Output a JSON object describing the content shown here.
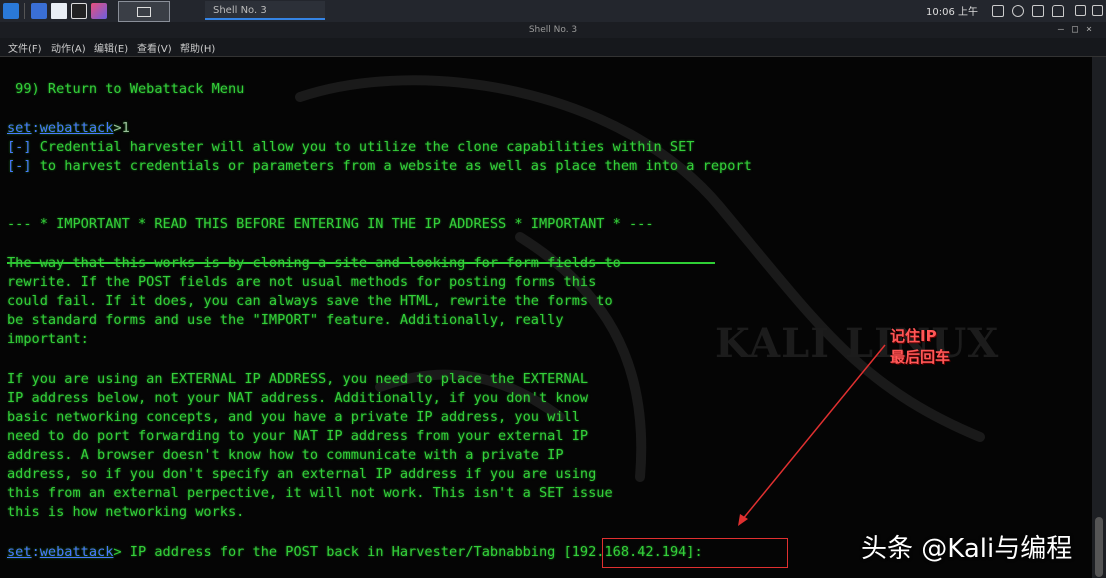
{
  "taskbar": {
    "task_label": "Shell No. 3",
    "clock": "10:06 上午"
  },
  "window": {
    "title": "Shell No. 3"
  },
  "menu": [
    "文件(F)",
    "动作(A)",
    "编辑(E)",
    "查看(V)",
    "帮助(H)"
  ],
  "terminal": {
    "return_line": " 99) Return to Webattack Menu",
    "prompt1_prefix": "set",
    "prompt1_module": "webattack",
    "prompt1_input": ">1",
    "info1_tag": "[-]",
    "info1_text": " Credential harvester will allow you to utilize the clone capabilities within SET",
    "info2_tag": "[-]",
    "info2_text": " to harvest credentials or parameters from a website as well as place them into a report",
    "important": "--- * IMPORTANT * READ THIS BEFORE ENTERING IN THE IP ADDRESS * IMPORTANT * ---",
    "para1": [
      "The way that this works is by cloning a site and looking for form fields to",
      "rewrite. If the POST fields are not usual methods for posting forms this",
      "could fail. If it does, you can always save the HTML, rewrite the forms to",
      "be standard forms and use the \"IMPORT\" feature. Additionally, really",
      "important:"
    ],
    "para2": [
      "If you are using an EXTERNAL IP ADDRESS, you need to place the EXTERNAL",
      "IP address below, not your NAT address. Additionally, if you don't know",
      "basic networking concepts, and you have a private IP address, you will",
      "need to do port forwarding to your NAT IP address from your external IP",
      "address. A browser doesn't know how to communicate with a private IP",
      "address, so if you don't specify an external IP address if you are using",
      "this from an external perpective, it will not work. This isn't a SET issue",
      "this is how networking works."
    ],
    "prompt2_prefix": "set",
    "prompt2_module": "webattack",
    "prompt2_text": "> IP address for the POST back in Harvester/Tabnabbing [192.168.42.194]:"
  },
  "watermark": "KALI LINUX",
  "annotation": [
    "记住IP",
    "最后回车"
  ],
  "brand": "头条 @Kali与编程",
  "colors": {
    "terminal_green": "#34d03a",
    "prompt_blue": "#4a78ff",
    "annotation_red": "#ff5757"
  }
}
